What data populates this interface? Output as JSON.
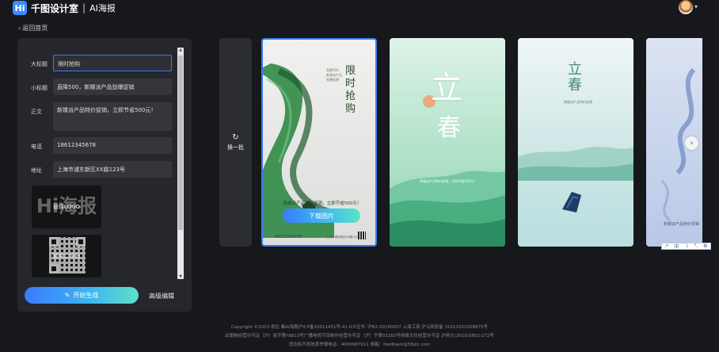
{
  "header": {
    "logo_mark": "Hi",
    "brand": "千图设计室",
    "separator": "|",
    "product": "AI海报",
    "avatar_caret": "▾"
  },
  "nav": {
    "back_label": "返回首页",
    "back_icon": "‹"
  },
  "form": {
    "title_label": "大标题",
    "title_value": "限时抢购",
    "subtitle_label": "小标题",
    "subtitle_value": "直降500，新媒派产品劲爆促销",
    "body_label": "正文",
    "body_value": "新媒派产品特价促销，立即节省500元！",
    "phone_label": "电话",
    "phone_value": "18612345678",
    "address_label": "地址",
    "address_value": "上海市浦东新区XX路123号",
    "logo_ghost": "Hi海报",
    "logo_slot_label": "替换LOGO",
    "qr_slot_label": "替换二维码"
  },
  "actions": {
    "generate_label": "开始生成",
    "generate_icon": "✎",
    "advanced_label": "高级编辑",
    "refresh_icon": "↻",
    "refresh_label": "换一批",
    "next_icon": "›"
  },
  "scroll": {
    "up": "▲",
    "down": "▼"
  },
  "posters": {
    "p1": {
      "title": "限时抢购",
      "side_text": "直降500 新媒派产品劲爆促销",
      "desc": "新媒派产品特价促销，立即节省500元！",
      "download_label": "下载图片",
      "phone": "18612345678",
      "address": "上海市浦东新区XX路123号"
    },
    "p2": {
      "big1": "立",
      "big2": "春",
      "slogan": "新媒派产品特价促销，立即节省500元！"
    },
    "p3": {
      "title": "立春",
      "sub": "新媒派产品特价促销"
    },
    "p4": {
      "text": "新媒派产品特价促销"
    }
  },
  "ime_toolbar": [
    "↗",
    "中",
    "☽",
    "°,",
    "⚙"
  ],
  "footer": {
    "line1": "Copyright ©2023-现在 集AI海报沪ICP备10011451号-41 ICP证书: 沪B2-20180057 上海工商 沪公网安备 31011502008675号",
    "line2": "出版物经营许可证（沪）批字第Y8813号广播电视节目制作经营许可证（沪）字第03283号网络文化经营许可证 沪网文(2019)3802-272号",
    "line3": "违法和不良信息举报电话：4009987011 邮箱：feedback@58pic.com"
  },
  "colors": {
    "accent": "#3a7afe",
    "background": "#17181b",
    "panel": "#25272c"
  }
}
